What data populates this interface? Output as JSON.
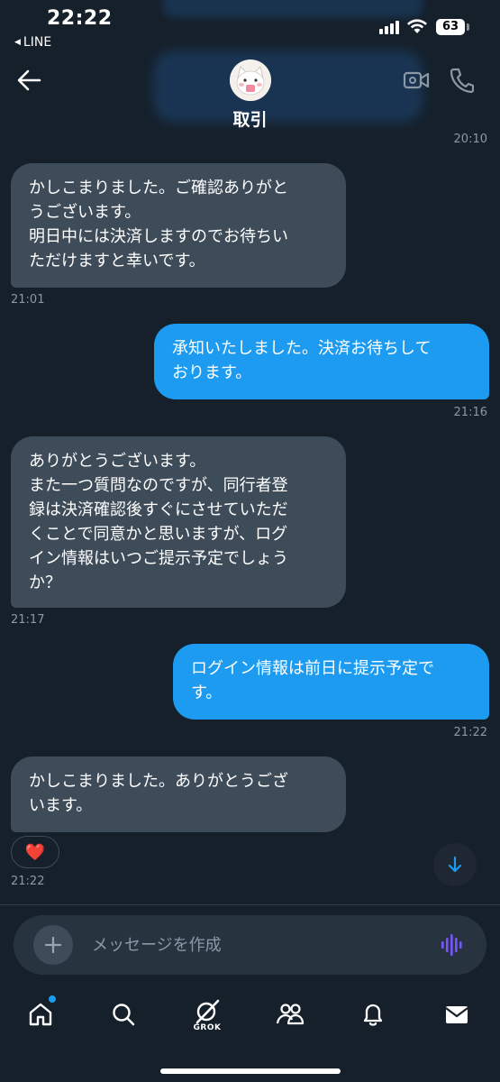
{
  "status_bar": {
    "time": "22:22",
    "back_app": "LINE",
    "battery": "63"
  },
  "header": {
    "contact_name": "取引",
    "previous_timestamp": "20:10"
  },
  "messages": [
    {
      "direction": "incoming",
      "text": "かしこまりました。ご確認ありがと\nうございます。\n明日中には決済しますのでお待ちい\nただけますと幸いです。",
      "time": "21:01"
    },
    {
      "direction": "outgoing",
      "text": "承知いたしました。決済お待ちして\nおります。",
      "time": "21:16"
    },
    {
      "direction": "incoming",
      "text": "ありがとうございます。\nまた一つ質問なのですが、同行者登\n録は決済確認後すぐにさせていただ\nくことで同意かと思いますが、ログ\nイン情報はいつご提示予定でしょう\nか？",
      "time": "21:17"
    },
    {
      "direction": "outgoing",
      "text": "ログイン情報は前日に提示予定で\nす。",
      "time": "21:22"
    },
    {
      "direction": "incoming",
      "text": "かしこまりました。ありがとうござ\nいます。",
      "time": "21:22",
      "reaction": "❤️"
    }
  ],
  "composer": {
    "placeholder": "メッセージを作成"
  },
  "bottom_nav": {
    "items": [
      {
        "icon": "home-icon",
        "has_notification": true
      },
      {
        "icon": "search-icon"
      },
      {
        "icon": "grok-icon",
        "label": "GROK"
      },
      {
        "icon": "communities-icon"
      },
      {
        "icon": "bell-icon"
      },
      {
        "icon": "mail-icon"
      }
    ]
  },
  "colors": {
    "background": "#15202b",
    "incoming_bubble": "#3e4b58",
    "outgoing_bubble": "#1d9bf0",
    "timestamp": "#8b98a5",
    "accent": "#1d9bf0"
  }
}
